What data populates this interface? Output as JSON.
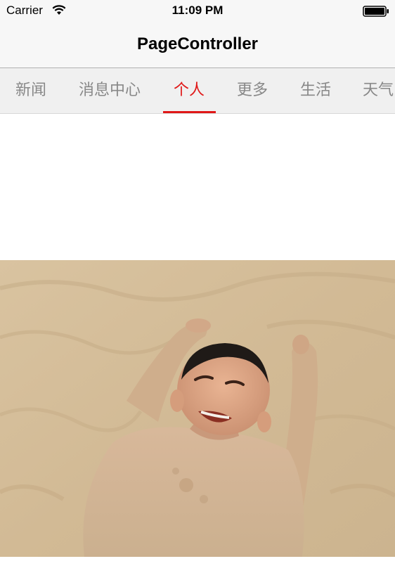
{
  "status_bar": {
    "carrier": "Carrier",
    "time": "11:09 PM",
    "wifi_icon": "wifi-icon",
    "battery_icon": "battery-icon"
  },
  "nav_bar": {
    "title": "PageController"
  },
  "tabs": [
    {
      "label": "新闻",
      "active": false
    },
    {
      "label": "消息中心",
      "active": false
    },
    {
      "label": "个人",
      "active": true
    },
    {
      "label": "更多",
      "active": false
    },
    {
      "label": "生活",
      "active": false
    },
    {
      "label": "天气",
      "active": false
    }
  ],
  "colors": {
    "accent": "#e01818",
    "tab_inactive": "#888888",
    "bar_background": "#f7f7f7",
    "tab_background": "#f0f0f0",
    "sand": "#d8c3a0"
  },
  "content": {
    "photo_subject": "child-buried-in-sand-photo"
  }
}
